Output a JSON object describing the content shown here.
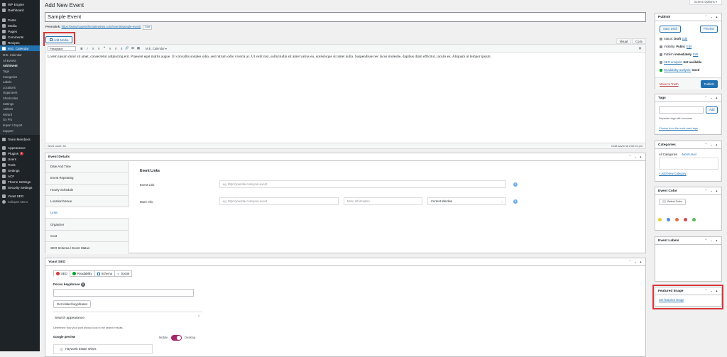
{
  "sidebar": {
    "items": [
      {
        "label": "WP Engine"
      },
      {
        "label": "Dashboard"
      },
      {
        "label": "Posts"
      },
      {
        "label": "Media"
      },
      {
        "label": "Pages"
      },
      {
        "label": "Comments"
      },
      {
        "label": "Recipes"
      },
      {
        "label": "M.E. Calendar"
      }
    ],
    "submenu": [
      "M.E. Calendar",
      "All Events",
      "Add Event",
      "Tags",
      "Categories",
      "Labels",
      "Locations",
      "Organizers",
      "Shortcodes",
      "Settings",
      "Addons",
      "Wizard",
      "Go Pro",
      "Import / Export",
      "Support"
    ],
    "items2": [
      {
        "label": "Team Members"
      },
      {
        "label": "Appearance"
      },
      {
        "label": "Plugins",
        "badge": "1"
      },
      {
        "label": "Users"
      },
      {
        "label": "Tools"
      },
      {
        "label": "Settings"
      },
      {
        "label": "ACF"
      },
      {
        "label": "Theme Settings"
      },
      {
        "label": "Security Settings"
      },
      {
        "label": "Yoast SEO"
      },
      {
        "label": "Collapse Menu"
      }
    ]
  },
  "header": {
    "screen_options": "Screen Options ▾",
    "page_title": "Add New Event"
  },
  "post": {
    "title": "Sample Event",
    "permalink_label": "Permalink:",
    "permalink_url": "https://www.hayworthestatewines.com/events/sample-event/",
    "permalink_edit": "Edit"
  },
  "editor": {
    "add_media": "Add Media",
    "tab_visual": "Visual",
    "tab_code": "Code",
    "format_select": "Paragraph",
    "toolbar_buttons": [
      "B",
      "I",
      "≡",
      "≡",
      "❝",
      "≡",
      "≡",
      "≡",
      "🔗",
      "⊠",
      "▦"
    ],
    "calendar_btn": "M.E. Calendar ▾",
    "body": "Lorem ipsum dolor sit amet, consectetur adipiscing elit. Praesent eget mattis augue. Ut convallis sodales odio, sed rutrum odio viverra ac. Ut velit nisl, sollicitudin sit amet varius eu, scelerisque sit amet nulla. Suspendisse nec lacus molestie, dapibus diam efficitur, iaculis ex. Aliquam ut tempor ipsum.",
    "word_count": "Word count: 46",
    "draft_saved": "Draft saved at 2:52:01 pm."
  },
  "event_details": {
    "title": "Event Details",
    "tabs": [
      "Date And Time",
      "Event Repeating",
      "Hourly Schedule",
      "Location/Venue",
      "Links",
      "Organizer",
      "Cost",
      "SEO Schema / Event Status"
    ],
    "links_title": "Event Links",
    "event_link_label": "Event Link",
    "event_link_placeholder": "eg. http://yoursite.com/your-event",
    "more_info_label": "More Info",
    "more_info_placeholder": "eg. http://yoursite.com/your-event",
    "more_info_text_placeholder": "More Information",
    "window_select": "Current Window"
  },
  "yoast": {
    "title": "Yoast SEO",
    "tabs": [
      "SEO",
      "Readability",
      "Schema",
      "Social"
    ],
    "focus_keyphrase": "Focus keyphrase",
    "related_btn": "Get related keyphrases",
    "search_appearance": "Search appearance",
    "search_desc": "Determine how your post should look in the search results.",
    "google_preview": "Google preview",
    "mobile": "Mobile",
    "desktop": "Desktop",
    "preview_site": "Hayworth Estate Wines"
  },
  "publish": {
    "title": "Publish",
    "save_draft": "Save Draft",
    "preview": "Preview",
    "status_label": "Status:",
    "status_value": "Draft",
    "visibility_label": "Visibility:",
    "visibility_value": "Public",
    "publish_label": "Publish",
    "publish_value": "immediately",
    "seo_label": "SEO analysis:",
    "seo_value": "Not available",
    "readability_label": "Readability analysis:",
    "readability_value": "Good",
    "edit": "Edit",
    "trash": "Move to Trash",
    "publish_btn": "Publish"
  },
  "tags": {
    "title": "Tags",
    "add": "Add",
    "hint": "Separate tags with commas",
    "choose": "Choose from the most used tags"
  },
  "categories": {
    "title": "Categories",
    "tab_all": "All Categories",
    "tab_most": "Most Used",
    "add_new": "+ Add New Category"
  },
  "event_color": {
    "title": "Event Color",
    "select": "Select Color",
    "swatches": [
      "#dcd33b",
      "#4f8de0",
      "#e0713b",
      "#d04a4a",
      "#5fb85b"
    ]
  },
  "event_labels": {
    "title": "Event Labels"
  },
  "featured_image": {
    "title": "Featured image",
    "set": "Set featured image"
  },
  "box_arrows": "⌃ ⌄ ▴"
}
